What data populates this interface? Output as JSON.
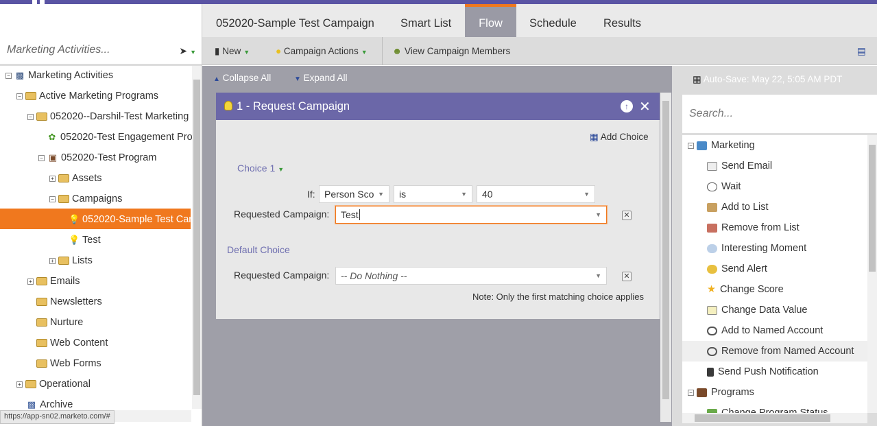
{
  "tabs": [
    {
      "label": "052020-Sample Test Campaign"
    },
    {
      "label": "Smart List"
    },
    {
      "label": "Flow",
      "active": true
    },
    {
      "label": "Schedule"
    },
    {
      "label": "Results"
    }
  ],
  "toolbar": {
    "new_label": "New",
    "campaign_actions_label": "Campaign Actions",
    "view_members_label": "View Campaign Members"
  },
  "left_panel": {
    "search_placeholder": "Marketing Activities...",
    "tree": [
      {
        "label": "Marketing Activities",
        "toggle": "⊟",
        "icon": "marketing-activities-icon"
      },
      {
        "label": "Active Marketing Programs",
        "toggle": "⊟",
        "icon": "folder-icon"
      },
      {
        "label": "052020--Darshil-Test Marketing",
        "toggle": "⊟",
        "icon": "folder-icon"
      },
      {
        "label": "052020-Test Engagement Pro",
        "toggle": "",
        "icon": "engagement-program-icon"
      },
      {
        "label": "052020-Test Program",
        "toggle": "⊟",
        "icon": "program-icon"
      },
      {
        "label": "Assets",
        "toggle": "⊞",
        "icon": "folder-icon"
      },
      {
        "label": "Campaigns",
        "toggle": "⊟",
        "icon": "folder-icon"
      },
      {
        "label": "052020-Sample Test Car",
        "toggle": "",
        "icon": "bulb-icon",
        "selected": true
      },
      {
        "label": "Test",
        "toggle": "",
        "icon": "bulb-icon"
      },
      {
        "label": "Lists",
        "toggle": "⊞",
        "icon": "folder-icon"
      },
      {
        "label": "Emails",
        "toggle": "⊞",
        "icon": "folder-icon"
      },
      {
        "label": "Newsletters",
        "toggle": "",
        "icon": "folder-icon"
      },
      {
        "label": "Nurture",
        "toggle": "",
        "icon": "folder-icon"
      },
      {
        "label": "Web Content",
        "toggle": "",
        "icon": "folder-icon"
      },
      {
        "label": "Web Forms",
        "toggle": "",
        "icon": "folder-icon"
      },
      {
        "label": "Operational",
        "toggle": "⊞",
        "icon": "folder-icon"
      },
      {
        "label": "Archive",
        "toggle": "",
        "icon": "archive-icon"
      }
    ],
    "status_url": "https://app-sn02.marketo.com/#"
  },
  "canvas": {
    "collapse_all": "Collapse All",
    "expand_all": "Expand All",
    "step": {
      "title": "1 - Request Campaign",
      "add_choice": "Add Choice",
      "choice_label": "Choice 1",
      "if_label": "If:",
      "condition_field": "Person Sco",
      "condition_operator": "is",
      "condition_value": "40",
      "requested_campaign_label": "Requested Campaign:",
      "requested_campaign_value": "Test",
      "default_choice_label": "Default Choice",
      "default_requested_campaign_label": "Requested Campaign:",
      "default_requested_campaign_value": "-- Do Nothing --",
      "note": "Note: Only the first matching choice applies"
    }
  },
  "right_panel": {
    "autosave": "Auto-Save: May 22, 5:05 AM PDT",
    "search_placeholder": "Search...",
    "groups": [
      {
        "label": "Marketing",
        "toggle": "⊟"
      },
      {
        "label": "Programs",
        "toggle": "⊟"
      }
    ],
    "items": [
      {
        "label": "Send Email",
        "icon": "send-email-icon"
      },
      {
        "label": "Wait",
        "icon": "wait-icon"
      },
      {
        "label": "Add to List",
        "icon": "add-to-list-icon"
      },
      {
        "label": "Remove from List",
        "icon": "remove-from-list-icon"
      },
      {
        "label": "Interesting Moment",
        "icon": "interesting-moment-icon"
      },
      {
        "label": "Send Alert",
        "icon": "send-alert-icon"
      },
      {
        "label": "Change Score",
        "icon": "star-icon"
      },
      {
        "label": "Change Data Value",
        "icon": "change-data-value-icon"
      },
      {
        "label": "Add to Named Account",
        "icon": "add-named-account-icon"
      },
      {
        "label": "Remove from Named Account",
        "icon": "remove-named-account-icon",
        "highlighted": true
      },
      {
        "label": "Send Push Notification",
        "icon": "push-notification-icon"
      },
      {
        "label": "Change Program Status",
        "icon": "change-program-status-icon"
      }
    ]
  },
  "colors": {
    "brand": "#5a54a4",
    "accent": "#f0781e",
    "step_header": "#6b67a8",
    "canvas_bg": "#9f9fa8"
  }
}
